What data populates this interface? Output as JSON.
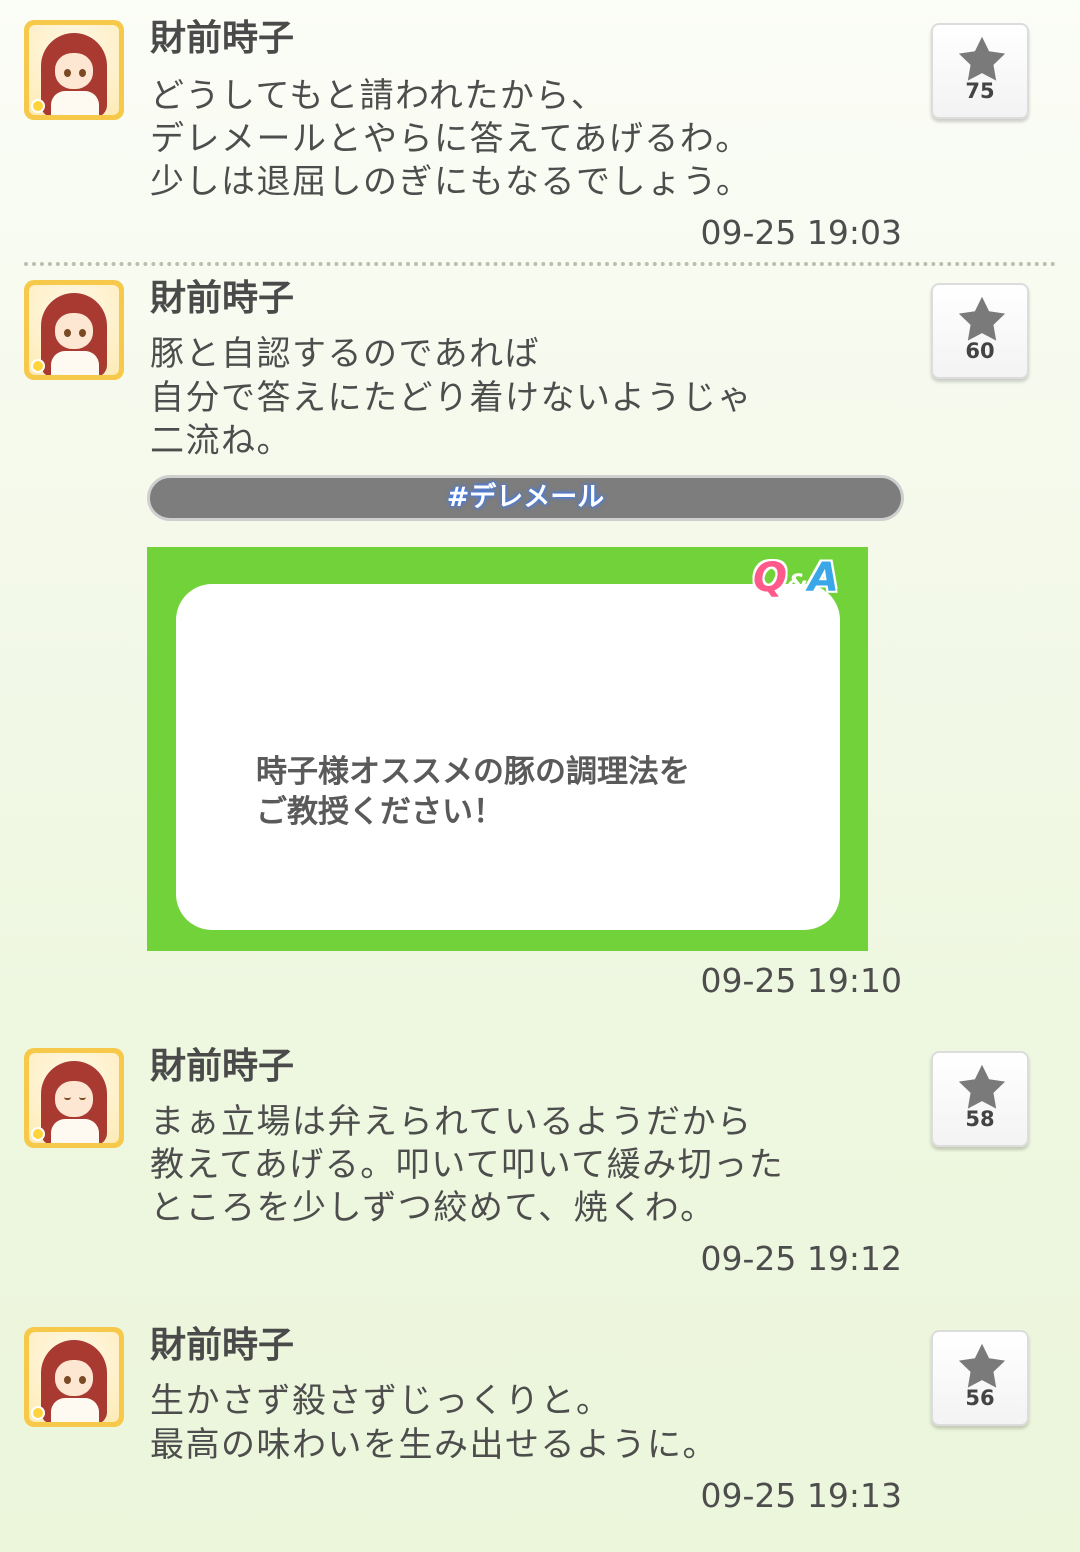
{
  "posts": [
    {
      "author": "財前時子",
      "lines": [
        "どうしてもと請われたから、",
        "デレメールとやらに答えてあげるわ。",
        "少しは退屈しのぎにもなるでしょう。"
      ],
      "time": "09-25 19:03",
      "stars": "75"
    },
    {
      "author": "財前時子",
      "lines": [
        "豚と自認するのであれば",
        "自分で答えにたどり着けないようじゃ",
        "二流ね。"
      ],
      "hashtag": "#デレメール",
      "qa_card": {
        "logo_q": "Q",
        "logo_amp": "&",
        "logo_a": "A",
        "question_lines": [
          "時子様オススメの豚の調理法を",
          "ご教授ください！"
        ]
      },
      "time": "09-25 19:10",
      "stars": "60"
    },
    {
      "author": "財前時子",
      "lines": [
        "まぁ立場は弁えられているようだから",
        "教えてあげる。叩いて叩いて緩み切った",
        "ところを少しずつ絞めて、焼くわ。"
      ],
      "time": "09-25 19:12",
      "stars": "58"
    },
    {
      "author": "財前時子",
      "lines": [
        "生かさず殺さずじっくりと。",
        "最高の味わいを生み出せるように。"
      ],
      "time": "09-25 19:13",
      "stars": "56"
    }
  ],
  "colors": {
    "star_icon": "#7a7a7a",
    "qa_green": "#72d23a",
    "hashtag_bar": "#7d7d7d",
    "avatar_frame": "#f6c94a"
  },
  "icons": [
    "star-icon",
    "avatar"
  ]
}
